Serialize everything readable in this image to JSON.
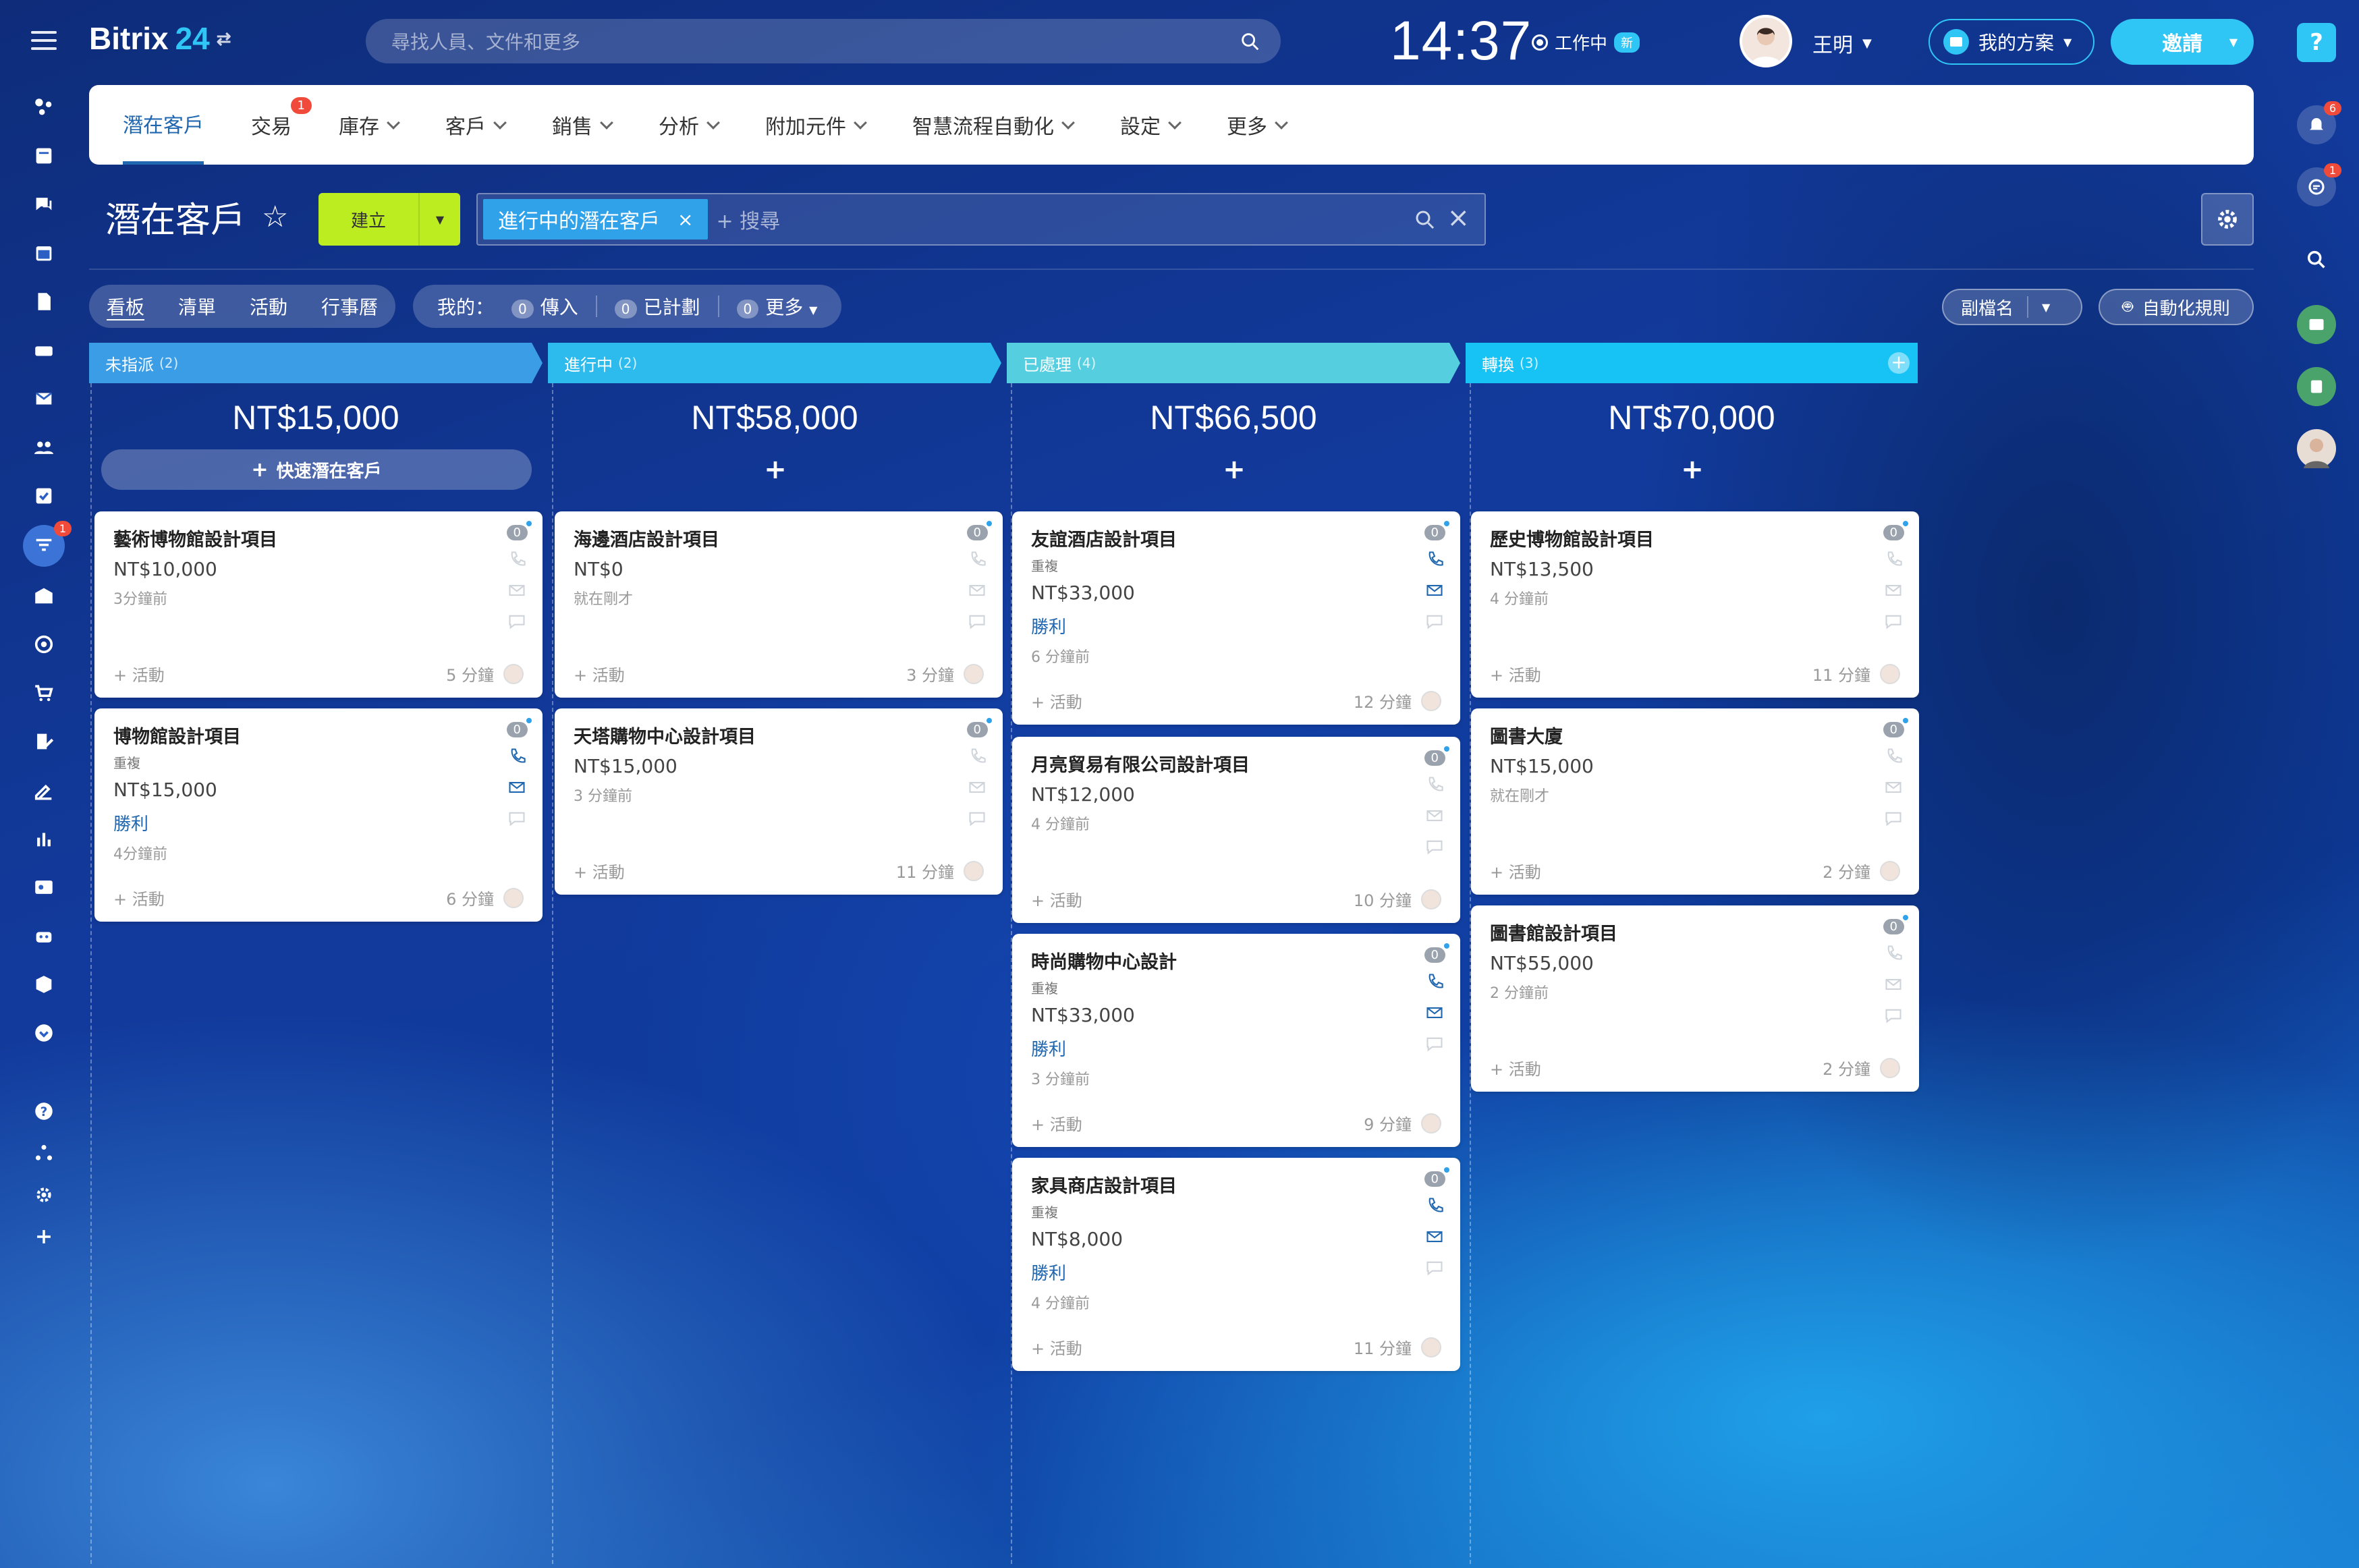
{
  "app": {
    "logo_name": "Bitrix",
    "logo_num": "24"
  },
  "search": {
    "placeholder": "尋找人員、文件和更多"
  },
  "clock": "14:37",
  "work_status": {
    "label": "工作中",
    "badge": "新"
  },
  "user": {
    "name": "王明"
  },
  "my_plan": "我的方案",
  "invite": "邀請",
  "left_sidebar": {
    "badge": "1"
  },
  "right_sidebar": {
    "notif_badge": "6",
    "chat_badge": "1"
  },
  "nav": [
    {
      "label": "潛在客戶"
    },
    {
      "label": "交易",
      "badge": "1"
    },
    {
      "label": "庫存"
    },
    {
      "label": "客戶"
    },
    {
      "label": "銷售"
    },
    {
      "label": "分析"
    },
    {
      "label": "附加元件"
    },
    {
      "label": "智慧流程自動化"
    },
    {
      "label": "設定"
    },
    {
      "label": "更多"
    }
  ],
  "page": {
    "title": "潛在客戶",
    "create": "建立",
    "filter_chip": "進行中的潛在客戶",
    "filter_search": "+ 搜尋"
  },
  "view_tabs": [
    "看板",
    "清單",
    "活動",
    "行事曆"
  ],
  "my_filters": {
    "label": "我的：",
    "items": [
      {
        "count": "0",
        "label": "傳入"
      },
      {
        "count": "0",
        "label": "已計劃"
      },
      {
        "count": "0",
        "label": "更多"
      }
    ]
  },
  "subname": "副檔名",
  "automation": "自動化規則",
  "quick_add": "快速潛在客戶",
  "colors": {
    "accent": "#2fc6f6",
    "create": "#bbed21",
    "link": "#2067b0"
  },
  "columns": [
    {
      "name": "未指派",
      "count": "(2)",
      "sum": "NT$15,000",
      "color": "#3b9de6"
    },
    {
      "name": "進行中",
      "count": "(2)",
      "sum": "NT$58,000",
      "color": "#2dbbee"
    },
    {
      "name": "已處理",
      "count": "(4)",
      "sum": "NT$66,500",
      "color": "#55cfe0"
    },
    {
      "name": "轉換",
      "count": "(3)",
      "sum": "NT$70,000",
      "color": "#17c3f5"
    }
  ],
  "cards": [
    {
      "title": "藝術博物館設計項目",
      "amount": "NT$10,000",
      "time": "3分鐘前",
      "activity": "+ 活動",
      "dur": "5 分鐘"
    },
    {
      "title": "博物館設計項目",
      "dup": "重複",
      "amount": "NT$15,000",
      "won": "勝利",
      "time": "4分鐘前",
      "activity": "+ 活動",
      "dur": "6 分鐘"
    },
    {
      "title": "海邊酒店設計項目",
      "amount": "NT$0",
      "time": "就在剛才",
      "activity": "+ 活動",
      "dur": "3 分鐘"
    },
    {
      "title": "天塔購物中心設計項目",
      "amount": "NT$15,000",
      "time": "3 分鐘前",
      "activity": "+ 活動",
      "dur": "11 分鐘"
    },
    {
      "title": "友誼酒店設計項目",
      "dup": "重複",
      "amount": "NT$33,000",
      "won": "勝利",
      "time": "6 分鐘前",
      "activity": "+ 活動",
      "dur": "12 分鐘"
    },
    {
      "title": "月亮貿易有限公司設計項目",
      "amount": "NT$12,000",
      "time": "4 分鐘前",
      "activity": "+ 活動",
      "dur": "10 分鐘"
    },
    {
      "title": "時尚購物中心設計",
      "dup": "重複",
      "amount": "NT$33,000",
      "won": "勝利",
      "time": "3 分鐘前",
      "activity": "+ 活動",
      "dur": "9 分鐘"
    },
    {
      "title": "家具商店設計項目",
      "dup": "重複",
      "amount": "NT$8,000",
      "won": "勝利",
      "time": "4 分鐘前",
      "activity": "+ 活動",
      "dur": "11 分鐘"
    },
    {
      "title": "歷史博物館設計項目",
      "amount": "NT$13,500",
      "time": "4 分鐘前",
      "activity": "+ 活動",
      "dur": "11 分鐘"
    },
    {
      "title": "圖書大廈",
      "amount": "NT$15,000",
      "time": "就在剛才",
      "activity": "+ 活動",
      "dur": "2 分鐘"
    },
    {
      "title": "圖書館設計項目",
      "amount": "NT$55,000",
      "time": "2 分鐘前",
      "activity": "+ 活動",
      "dur": "2 分鐘"
    }
  ],
  "zero": "0"
}
